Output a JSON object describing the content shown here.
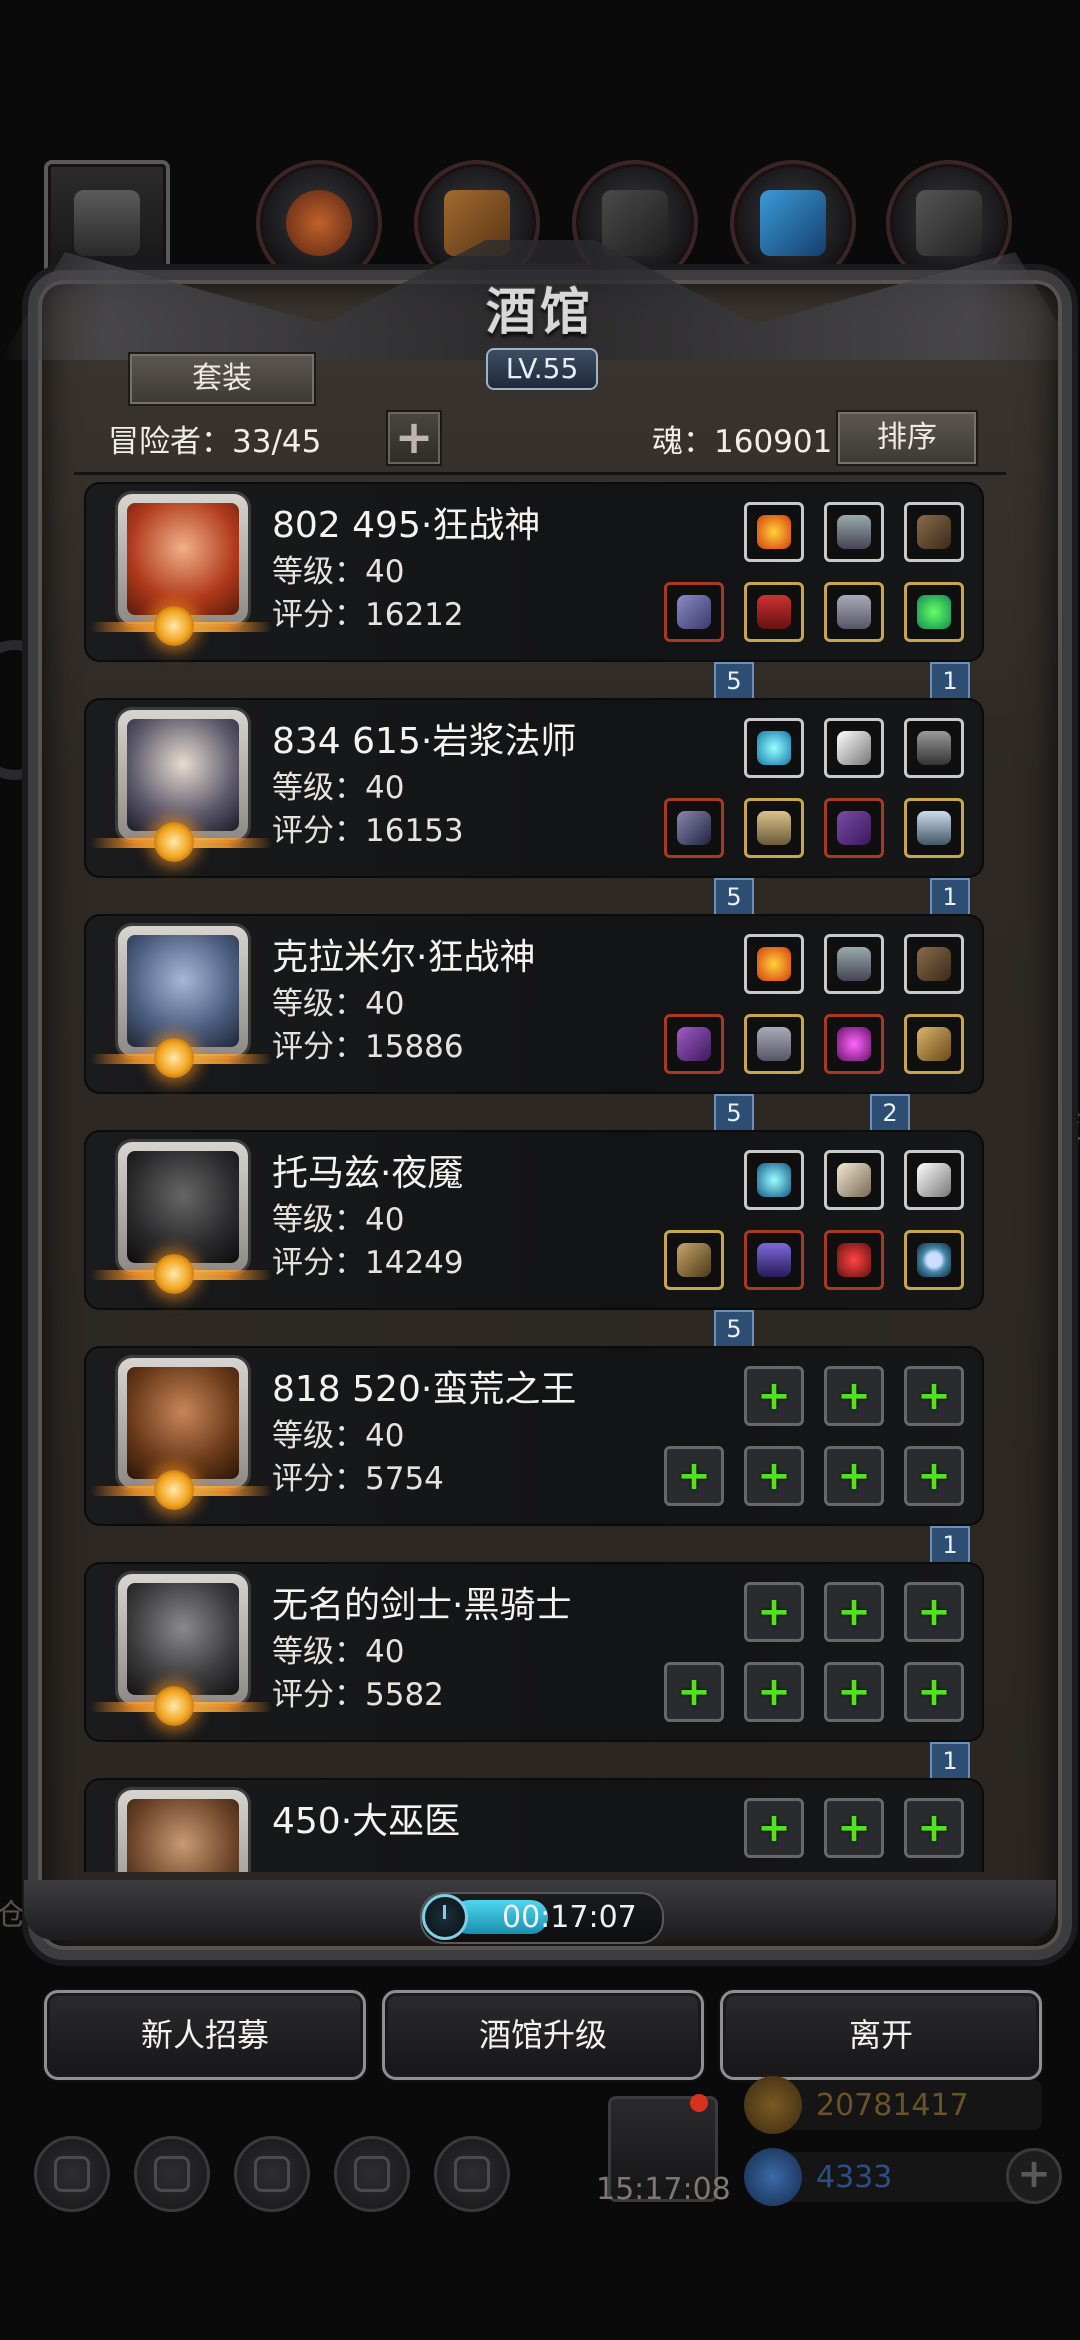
{
  "title": "酒馆",
  "level_badge": "LV.55",
  "buttons": {
    "set": "套装",
    "sort": "排序",
    "add_slot": "+"
  },
  "adventurer_count": "冒险者：33/45",
  "soul": "魂：160901",
  "heroes": [
    {
      "name": "802 495·狂战神",
      "level": "等级：40",
      "score": "评分：16212",
      "ribbons": [
        "5",
        "1"
      ]
    },
    {
      "name": "834 615·岩浆法师",
      "level": "等级：40",
      "score": "评分：16153",
      "ribbons": [
        "5",
        "1"
      ]
    },
    {
      "name": "克拉米尔·狂战神",
      "level": "等级：40",
      "score": "评分：15886",
      "ribbons": [
        "5",
        "2"
      ]
    },
    {
      "name": "托马兹·夜魇",
      "level": "等级：40",
      "score": "评分：14249",
      "ribbons": [
        "5"
      ]
    },
    {
      "name": "818 520·蛮荒之王",
      "level": "等级：40",
      "score": "评分：5754",
      "ribbons": [
        "1"
      ]
    },
    {
      "name": "无名的剑士·黑骑士",
      "level": "等级：40",
      "score": "评分：5582",
      "ribbons": [
        "1"
      ]
    },
    {
      "name": "450·大巫医",
      "level": "",
      "score": "",
      "ribbons": []
    }
  ],
  "timer": "00:17:07",
  "actions": {
    "recruit": "新人招募",
    "upgrade": "酒馆升级",
    "leave": "离开"
  },
  "hud": {
    "time": "15:17:08",
    "gold": "20781417",
    "gems": "4333"
  },
  "background_text": {
    "right": "技",
    "left": "仓"
  },
  "colors": {
    "plus_green": "#54e21e",
    "ribbon_blue": "#2d4d73",
    "gold_value": "#6b5227",
    "gem_value": "#2a4f86"
  }
}
